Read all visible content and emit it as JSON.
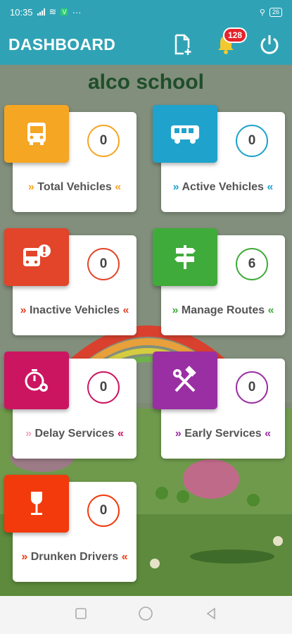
{
  "status_bar": {
    "time": "10:35",
    "battery": "26"
  },
  "app_bar": {
    "title": "DASHBOARD",
    "notification_count": "128"
  },
  "school_name": "alco school",
  "cards": [
    {
      "label": "Total Vehicles",
      "count": "0",
      "color": "#f5a623",
      "icon": "bus-icon"
    },
    {
      "label": "Active Vehicles",
      "count": "0",
      "color": "#1fa3cc",
      "icon": "bus-side-icon"
    },
    {
      "label": "Inactive Vehicles",
      "count": "0",
      "color": "#e2452a",
      "icon": "bus-alert-icon"
    },
    {
      "label": "Manage Routes",
      "count": "6",
      "color": "#3fab3a",
      "icon": "signpost-icon"
    },
    {
      "label": "Delay Services",
      "count": "0",
      "color": "#cc1560",
      "icon": "timer-gear-icon"
    },
    {
      "label": "Early Services",
      "count": "0",
      "color": "#9a2fa3",
      "icon": "hammer-wrench-icon"
    },
    {
      "label": "Drunken Drivers",
      "count": "0",
      "color": "#f23a0c",
      "icon": "wine-glass-icon"
    }
  ]
}
